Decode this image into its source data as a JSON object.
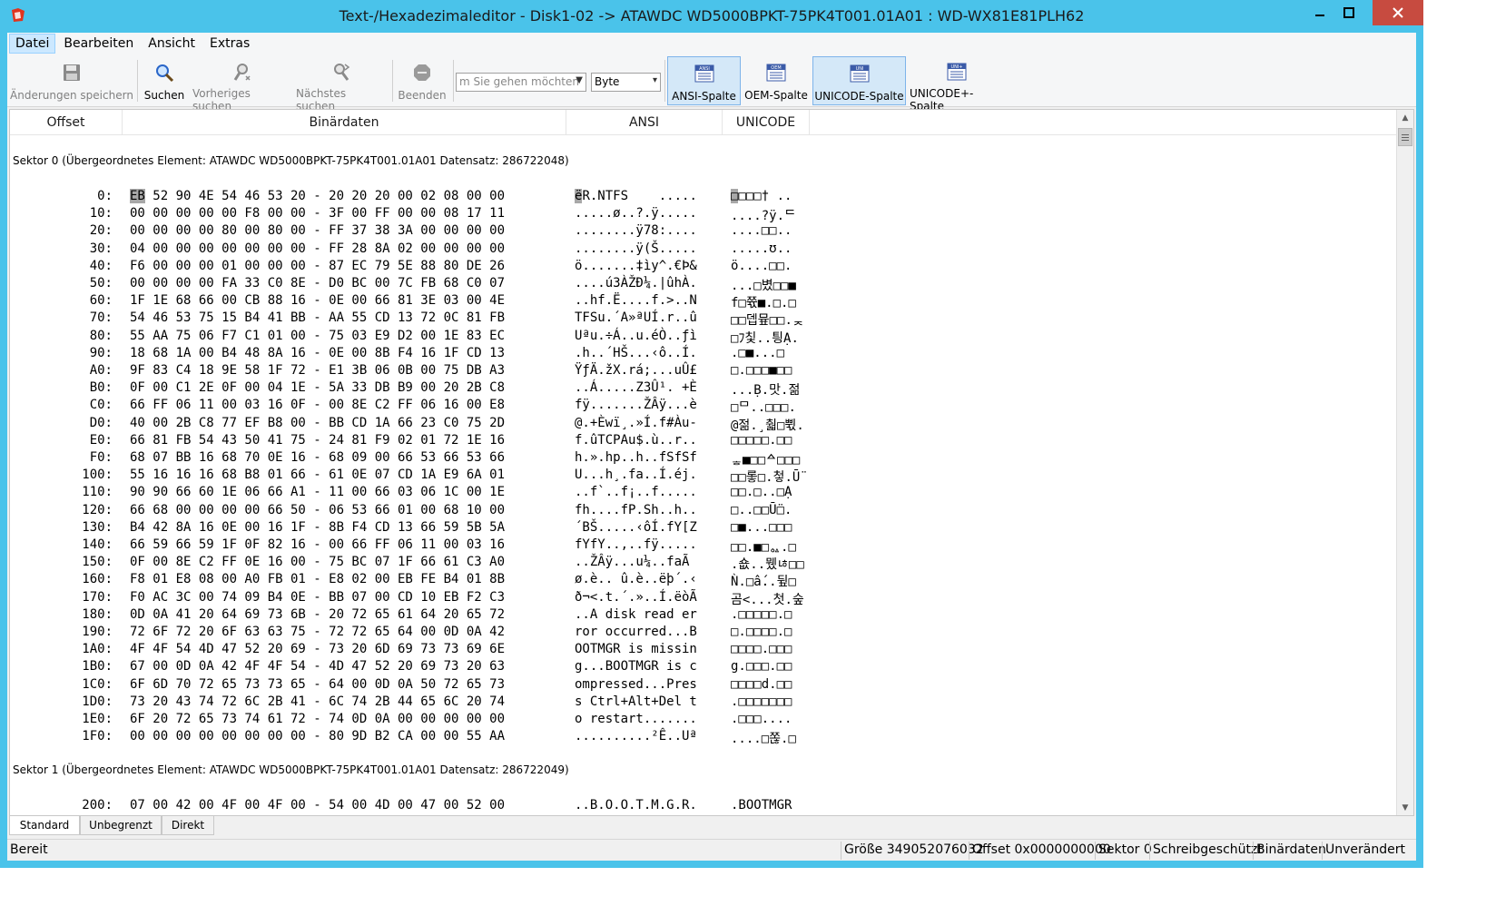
{
  "window": {
    "title": "Text-/Hexadezimaleditor - Disk1-02 -> ATAWDC WD5000BPKT-75PK4T001.01A01 : WD-WX81E81PLH62",
    "app_icon": "red-app-icon",
    "minimize_icon": "minimize-icon",
    "maximize_icon": "maximize-icon",
    "close_icon": "close-icon"
  },
  "menu": {
    "items": [
      {
        "label": "Datei",
        "active": true
      },
      {
        "label": "Bearbeiten"
      },
      {
        "label": "Ansicht"
      },
      {
        "label": "Extras"
      }
    ]
  },
  "toolbar": {
    "save_label": "Änderungen speichern",
    "search_label": "Suchen",
    "prev_label": "Vorheriges suchen",
    "next_label": "Nächstes suchen",
    "exit_label": "Beenden",
    "goto_placeholder": "m Sie gehen möchten",
    "unit_value": "Byte",
    "ansi_col_label": "ANSI-Spalte",
    "oem_col_label": "OEM-Spalte",
    "unicode_col_label": "UNICODE-Spalte",
    "unicode_plus_label": "UNICODE+-Spalte",
    "ansi_icon_text": "ANSI",
    "oem_icon_text": "OEM",
    "uni_icon_text": "UNI",
    "uniplus_icon_text": "UNI+"
  },
  "columns": {
    "offset": "Offset",
    "binary": "Binärdaten",
    "ansi": "ANSI",
    "unicode": "UNICODE"
  },
  "sectors": [
    {
      "label": "Sektor 0 (Übergeordnetes Element: ATAWDC WD5000BPKT-75PK4T001.01A01 Datensatz: 286722048)",
      "rows": [
        {
          "off": "0:",
          "hex": "EB 52 90 4E 54 46 53 20 - 20 20 20 00 02 08 00 00",
          "ansi": "ëR.NTFS    .....",
          "uni": "□□□□† .."
        },
        {
          "off": "10:",
          "hex": "00 00 00 00 00 F8 00 00 - 3F 00 FF 00 00 08 17 11",
          "ansi": ".....ø..?.ÿ.....",
          "uni": "....?ÿ.ᄃ"
        },
        {
          "off": "20:",
          "hex": "00 00 00 00 80 00 80 00 - FF 37 38 3A 00 00 00 00",
          "ansi": "........ÿ78:....",
          "uni": "....□□.."
        },
        {
          "off": "30:",
          "hex": "04 00 00 00 00 00 00 00 - FF 28 8A 02 00 00 00 00",
          "ansi": "........ÿ(Š.....",
          "uni": ".....ʊ.."
        },
        {
          "off": "40:",
          "hex": "F6 00 00 00 01 00 00 00 - 87 EC 79 5E 88 80 DE 26",
          "ansi": "ö.......‡ìy^.€Þ&",
          "uni": "ö....□□."
        },
        {
          "off": "50:",
          "hex": "00 00 00 00 FA 33 C0 8E - D0 BC 00 7C FB 68 C0 07",
          "ansi": "....ú3ÀŽÐ¼.|ûhÀ.",
          "uni": "...□볐□□■"
        },
        {
          "off": "60:",
          "hex": "1F 1E 68 66 00 CB 88 16 - 0E 00 66 81 3E 03 00 4E",
          "ansi": "..hf.Ë....f.>..N",
          "uni": "f□쮻■.□.□"
        },
        {
          "off": "70:",
          "hex": "54 46 53 75 15 B4 41 BB - AA 55 CD 13 72 0C 81 FB",
          "ansi": "TFSu.´A»ªUÍ.r..û",
          "uni": "□□뎁뮾□□.ᆽ"
        },
        {
          "off": "80:",
          "hex": "55 AA 75 06 F7 C1 01 00 - 75 03 E9 D2 00 1E 83 EC",
          "ansi": "Uªu.÷Á..u.éÒ..ƒì",
          "uni": "□ﾌ칯..틩Ạ."
        },
        {
          "off": "90:",
          "hex": "18 68 1A 00 B4 48 8A 16 - 0E 00 8B F4 16 1F CD 13",
          "ansi": ".h..´HŠ...‹ô..Í.",
          "uni": ".□■...□"
        },
        {
          "off": "A0:",
          "hex": "9F 83 C4 18 9E 58 1F 72 - E1 3B 06 0B 00 75 DB A3",
          "ansi": "ŸƒÄ.žX.rá;...uÛ£",
          "uni": "□.□□□■□□"
        },
        {
          "off": "B0:",
          "hex": "0F 00 C1 2E 0F 00 04 1E - 5A 33 DB B9 00 20 2B C8",
          "ansi": "..Á.....Z3Û¹. +È",
          "uni": "...Ḅ.맛.젊"
        },
        {
          "off": "C0:",
          "hex": "66 FF 06 11 00 03 16 0F - 00 8E C2 FF 06 16 00 E8",
          "ansi": "fÿ.......ŽÂÿ...è",
          "uni": "□ᄆ..□□□."
        },
        {
          "off": "D0:",
          "hex": "40 00 2B C8 77 EF B8 00 - BB CD 1A 66 23 C0 75 2D",
          "ansi": "@.+Èwï¸.»Í.f#Àu-",
          "uni": "@젊.¸춻□쀣."
        },
        {
          "off": "E0:",
          "hex": "66 81 FB 54 43 50 41 75 - 24 81 F9 02 01 72 1E 16",
          "ansi": "f.ûTCPAu$.ù..r..",
          "uni": "□□□□□.□□"
        },
        {
          "off": "F0:",
          "hex": "68 07 BB 16 68 70 0E 16 - 68 09 00 66 53 66 53 66",
          "ansi": "h.».hp..h..fSfSf",
          "uni": "ᇂ■□□ᅀ□□□"
        },
        {
          "off": "100:",
          "hex": "55 16 16 16 68 B8 01 66 - 61 0E 07 CD 1A E9 6A 01",
          "ansi": "U...h¸.fa..Í.éj.",
          "uni": "□□롷□.첳.Ṻ"
        },
        {
          "off": "110:",
          "hex": "90 90 66 60 1E 06 66 A1 - 11 00 66 03 06 1C 00 1E",
          "ansi": "..f`..f¡..f.....",
          "uni": "□□.□..□Ạ"
        },
        {
          "off": "120:",
          "hex": "66 68 00 00 00 00 66 50 - 06 53 66 01 00 68 10 00",
          "ansi": "fh....fP.Sh..h..",
          "uni": "□..□□Ṻ□."
        },
        {
          "off": "130:",
          "hex": "B4 42 8A 16 0E 00 16 1F - 8B F4 CD 13 66 59 5B 5A",
          "ansi": "´BŠ.....‹ôÍ.fY[Z",
          "uni": "□■...□□□"
        },
        {
          "off": "140:",
          "hex": "66 59 66 59 1F 0F 82 16 - 00 66 FF 06 11 00 03 16",
          "ansi": "fYfY..‚..fÿ.....",
          "uni": "□□.■□ᇲ.□"
        },
        {
          "off": "150:",
          "hex": "0F 00 8E C2 FF 0E 16 00 - 75 BC 07 1F 66 61 C3 A0",
          "ansi": "..ŽÂÿ...u¼..faÃ ",
          "uni": ".숎..뮀ﾦ□□"
        },
        {
          "off": "160:",
          "hex": "F8 01 E8 08 00 A0 FB 01 - E8 02 00 EB FE B4 01 8B",
          "ansi": "ø.è.. û.è..ëþ´.‹",
          "uni": "Ǹ.□ấ..뒾□"
        },
        {
          "off": "170:",
          "hex": "F0 AC 3C 00 74 09 B4 0E - BB 07 00 CD 10 EB F2 C3",
          "ansi": "ð¬<.t.´.»..Í.ëòÃ",
          "uni": "곰<...첫.숲"
        },
        {
          "off": "180:",
          "hex": "0D 0A 41 20 64 69 73 6B - 20 72 65 61 64 20 65 72",
          "ansi": "..A disk read er",
          "uni": ".□□□□□.□"
        },
        {
          "off": "190:",
          "hex": "72 6F 72 20 6F 63 63 75 - 72 72 65 64 00 0D 0A 42",
          "ansi": "ror occurred...B",
          "uni": "□.□□□□.□"
        },
        {
          "off": "1A0:",
          "hex": "4F 4F 54 4D 47 52 20 69 - 73 20 6D 69 73 73 69 6E",
          "ansi": "OOTMGR is missin",
          "uni": "□□□□.□□□"
        },
        {
          "off": "1B0:",
          "hex": "67 00 0D 0A 42 4F 4F 54 - 4D 47 52 20 69 73 20 63",
          "ansi": "g...BOOTMGR is c",
          "uni": "g.□□□.□□"
        },
        {
          "off": "1C0:",
          "hex": "6F 6D 70 72 65 73 73 65 - 64 00 0D 0A 50 72 65 73",
          "ansi": "ompressed...Pres",
          "uni": "□□□□d.□□"
        },
        {
          "off": "1D0:",
          "hex": "73 20 43 74 72 6C 2B 41 - 6C 74 2B 44 65 6C 20 74",
          "ansi": "s Ctrl+Alt+Del t",
          "uni": ".□□□□□□□"
        },
        {
          "off": "1E0:",
          "hex": "6F 20 72 65 73 74 61 72 - 74 0D 0A 00 00 00 00 00",
          "ansi": "o restart.......",
          "uni": ".□□□...."
        },
        {
          "off": "1F0:",
          "hex": "00 00 00 00 00 00 00 00 - 80 9D B2 CA 00 00 55 AA",
          "ansi": "..........²Ê..Uª",
          "uni": "....□쫂.□"
        }
      ]
    },
    {
      "label": "Sektor 1 (Übergeordnetes Element: ATAWDC WD5000BPKT-75PK4T001.01A01 Datensatz: 286722049)",
      "rows": [
        {
          "off": "200:",
          "hex": "07 00 42 00 4F 00 4F 00 - 54 00 4D 00 47 00 52 00",
          "ansi": "..B.O.O.T.M.G.R.",
          "uni": ".BOOTMGR"
        }
      ]
    }
  ],
  "tabs": [
    {
      "label": "Standard",
      "active": true
    },
    {
      "label": "Unbegrenzt"
    },
    {
      "label": "Direkt"
    }
  ],
  "status": {
    "main": "Bereit",
    "size": "Größe 349052076032",
    "offset": "Offset 0x0000000000",
    "sector": "Sektor 0",
    "write": "Schreibgeschützt",
    "mode": "Binärdaten",
    "state": "Unverändert"
  },
  "colors": {
    "titlebar": "#4ac3ea",
    "close_button": "#c74b40",
    "menu_active": "#cce8ff",
    "toggle_bg": "#d4e8f8",
    "selection": "#a8a8a8"
  }
}
